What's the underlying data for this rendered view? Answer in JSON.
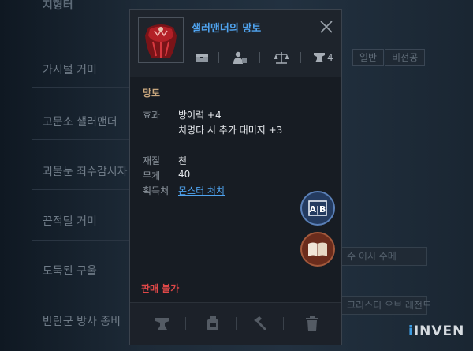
{
  "background": {
    "title": "지형터",
    "items": [
      "가시털 거미",
      "고문소 샐러맨더",
      "괴물눈 죄수감시자",
      "끈적털 거미",
      "도둑된 구울",
      "반란군 방사 종비"
    ],
    "chips": [
      "일반",
      "비전공"
    ],
    "right_texts": [
      "수 이시 수메",
      "크리스티 오브 레전드"
    ]
  },
  "popup": {
    "item_name": "샐러맨더의 망토",
    "hammer_count": "4",
    "category": "망토",
    "effect_label": "효과",
    "effects": [
      "방어력 +4",
      "치명타 시 추가 대미지 +3"
    ],
    "material_label": "재질",
    "material_value": "천",
    "weight_label": "무게",
    "weight_value": "40",
    "source_label": "획득처",
    "source_value": "몬스터 처치",
    "not_for_sale": "판매 불가"
  },
  "buttons": {
    "compare_label": "A|B"
  },
  "watermark": {
    "prefix": "",
    "text": "INVEN",
    "dot": "ⅰ"
  },
  "colors": {
    "item_name": "#4fa3ef",
    "category": "#c9a77e",
    "not_for_sale": "#e04848",
    "link": "#4fa3ef"
  }
}
